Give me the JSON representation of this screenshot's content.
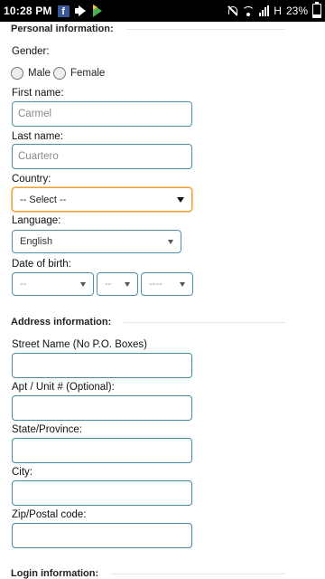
{
  "status_bar": {
    "time": "10:28 PM",
    "battery": "23%",
    "network": "H"
  },
  "personal": {
    "title": "Personal information:",
    "gender_label": "Gender:",
    "gender_options": [
      "Male",
      "Female"
    ],
    "first_name_label": "First name:",
    "first_name_value": "Carmel",
    "last_name_label": "Last name:",
    "last_name_value": "Cuartero",
    "country_label": "Country:",
    "country_selected": "-- Select --",
    "language_label": "Language:",
    "language_selected": "English",
    "dob_label": "Date of birth:",
    "dob_month": "--",
    "dob_day": "--",
    "dob_year": "----"
  },
  "address": {
    "title": "Address information:",
    "street_label": "Street Name (No P.O. Boxes)",
    "apt_label": "Apt / Unit # (Optional):",
    "state_label": "State/Province:",
    "city_label": "City:",
    "zip_label": "Zip/Postal code:"
  },
  "login": {
    "title": "Login information:"
  }
}
